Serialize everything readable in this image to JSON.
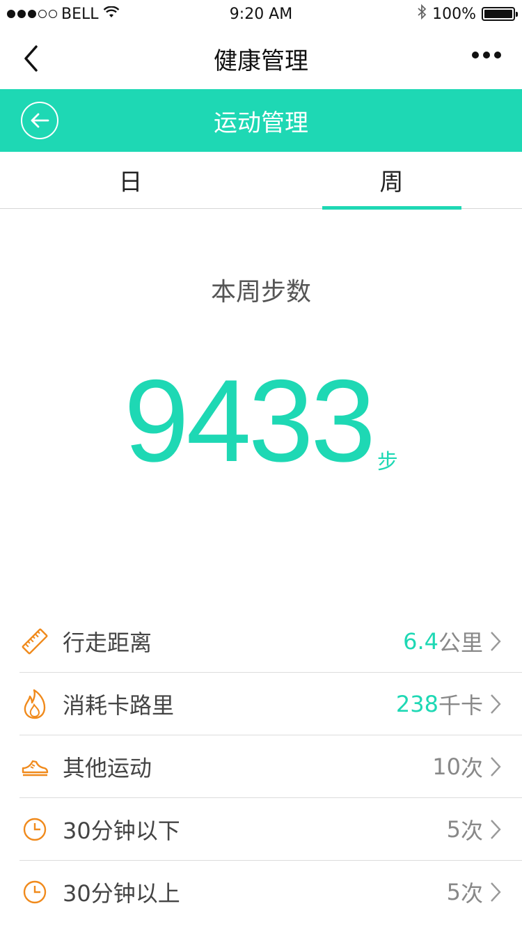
{
  "status_bar": {
    "carrier": "BELL",
    "time": "9:20 AM",
    "battery": "100%",
    "battery_level": 1.0,
    "signal_strength": 3,
    "signal_max": 5
  },
  "nav": {
    "title": "健康管理",
    "back_icon": "chevron-left-icon",
    "more_icon": "more-dots-icon"
  },
  "header": {
    "title": "运动管理",
    "back_icon": "arrow-left-circle-icon",
    "background_color": "#1ed8b4"
  },
  "tabs": [
    {
      "label": "日",
      "active": false
    },
    {
      "label": "周",
      "active": true
    }
  ],
  "summary": {
    "label": "本周步数",
    "value": "9433",
    "unit": "步",
    "accent_color": "#1ed8b4"
  },
  "stats": [
    {
      "icon": "ruler-icon",
      "label": "行走距离",
      "value": "6.4",
      "unit": "公里",
      "accent": true
    },
    {
      "icon": "flame-icon",
      "label": "消耗卡路里",
      "value": "238",
      "unit": "千卡",
      "accent": true
    },
    {
      "icon": "sneaker-icon",
      "label": "其他运动",
      "value": "10",
      "unit": "次",
      "accent": false
    },
    {
      "icon": "clock-icon",
      "label": "30分钟以下",
      "value": "5",
      "unit": "次",
      "accent": false
    },
    {
      "icon": "clock-icon",
      "label": "30分钟以上",
      "value": "5",
      "unit": "次",
      "accent": false
    }
  ],
  "icon_color": "#f08a1c"
}
